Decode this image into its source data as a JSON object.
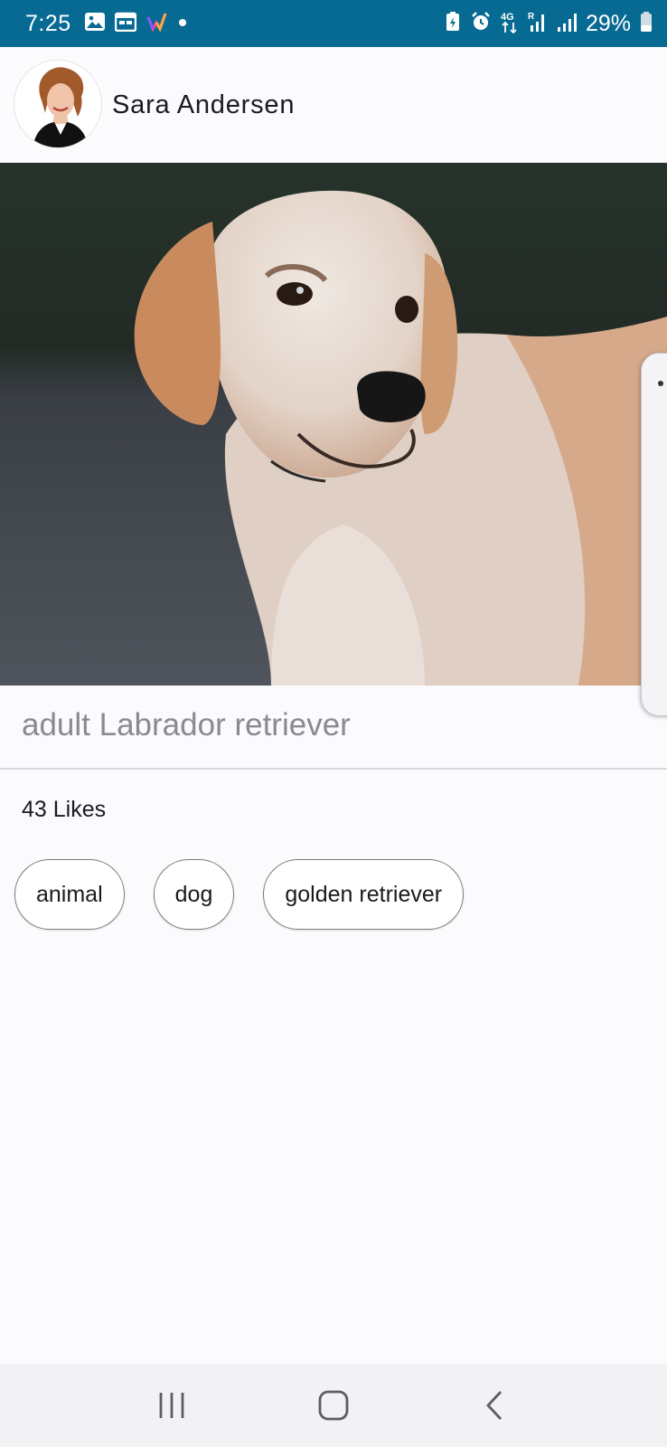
{
  "status_bar": {
    "time": "7:25",
    "network": "4G",
    "roaming": "R",
    "battery_percent": "29%",
    "left_icons": [
      "gallery-icon",
      "calendar-icon",
      "app-icon",
      "dot-icon"
    ],
    "right_icons": [
      "battery-saver-icon",
      "alarm-icon",
      "network-4g-icon",
      "signal-roaming-icon",
      "signal-icon",
      "battery-icon"
    ],
    "background_color": "#076a93"
  },
  "profile": {
    "name": "Sara Andersen"
  },
  "post": {
    "photo_subject": "dog-photo",
    "caption": "adult Labrador retriever",
    "likes": "43 Likes",
    "tags": [
      "animal",
      "dog",
      "golden retriever"
    ]
  },
  "nav_bar": {
    "buttons": [
      "recents-icon",
      "home-icon",
      "back-icon"
    ]
  }
}
